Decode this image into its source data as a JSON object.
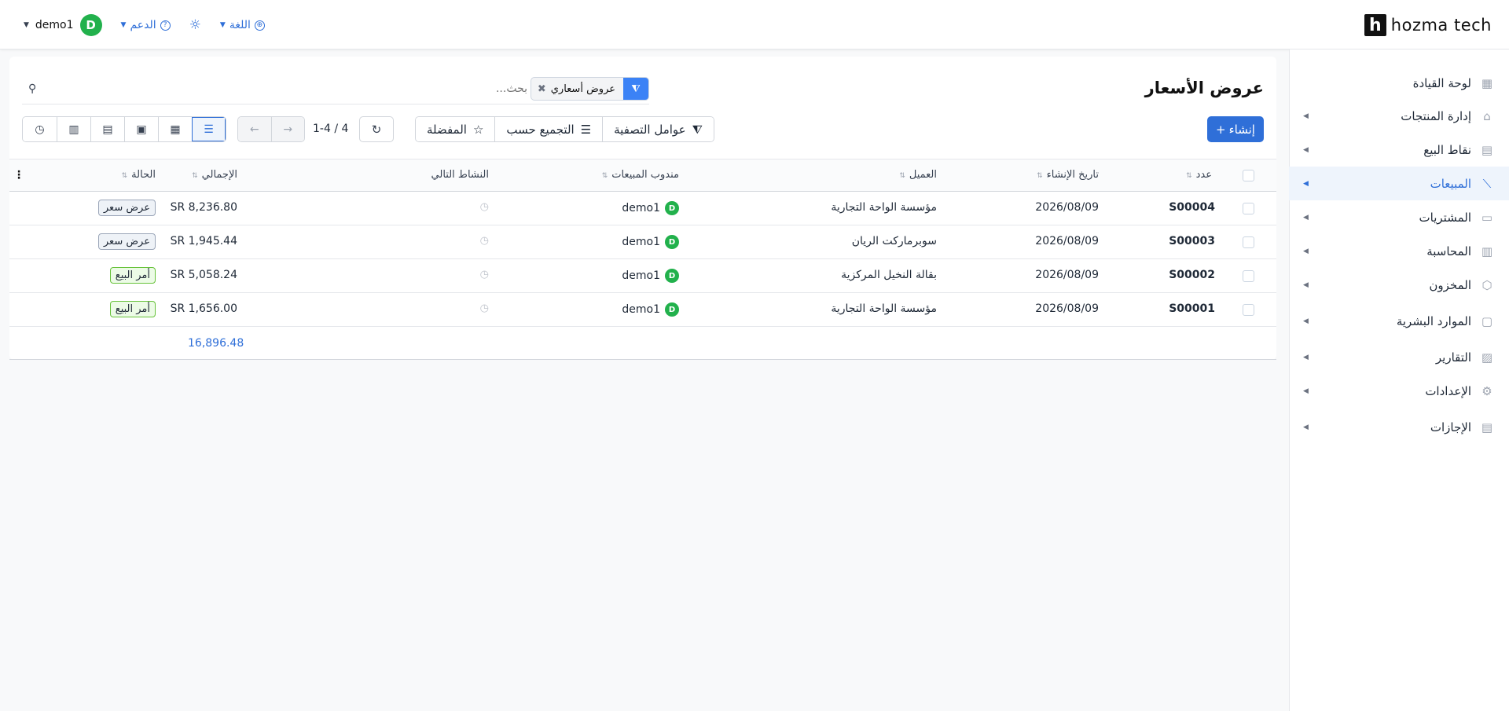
{
  "brand": {
    "mark": "h",
    "name": "hozma tech"
  },
  "topbar": {
    "user_name": "demo1",
    "user_initial": "D",
    "support_label": "الدعم",
    "language_label": "اللغة"
  },
  "sidebar": {
    "items": [
      {
        "label": "لوحة القيادة",
        "icon": "dashboard-icon",
        "glyph": "▦",
        "has_submenu": false
      },
      {
        "label": "إدارة المنتجات",
        "icon": "tag-icon",
        "glyph": "⌂",
        "has_submenu": true
      },
      {
        "label": "نقاط البيع",
        "icon": "store-icon",
        "glyph": "▤",
        "has_submenu": true
      },
      {
        "label": "المبيعات",
        "icon": "chart-line-icon",
        "glyph": "⟋",
        "has_submenu": true,
        "active": true
      },
      {
        "label": "المشتريات",
        "icon": "wallet-icon",
        "glyph": "▭",
        "has_submenu": true
      },
      {
        "label": "المحاسبة",
        "icon": "ledger-icon",
        "glyph": "▥",
        "has_submenu": true
      },
      {
        "label": "المخزون",
        "icon": "box-icon",
        "glyph": "⬡",
        "has_submenu": true
      },
      {
        "label": "الموارد البشرية",
        "icon": "document-icon",
        "glyph": "▢",
        "has_submenu": true
      },
      {
        "label": "التقارير",
        "icon": "report-icon",
        "glyph": "▨",
        "has_submenu": true
      },
      {
        "label": "الإعدادات",
        "icon": "gear-icon",
        "glyph": "⚙",
        "has_submenu": true
      },
      {
        "label": "الإجازات",
        "icon": "calendar-doc-icon",
        "glyph": "▤",
        "has_submenu": true
      }
    ]
  },
  "page": {
    "title": "عروض الأسعار",
    "create_label": "إنشاء",
    "search": {
      "facet_label": "عروض أسعاري",
      "placeholder": "بحث..."
    },
    "toolbar": {
      "filters_label": "عوامل التصفية",
      "group_by_label": "التجميع حسب",
      "favorites_label": "المفضلة"
    },
    "pager": "1-4 / 4"
  },
  "table": {
    "columns": {
      "number": "عدد",
      "created": "تاريخ الإنشاء",
      "customer": "العميل",
      "salesperson": "مندوب المبيعات",
      "next_activity": "النشاط التالي",
      "total": "الإجمالي",
      "status": "الحالة"
    },
    "rows": [
      {
        "number": "S00004",
        "created": "2026/08/09",
        "customer": "مؤسسة الواحة التجارية",
        "salesperson": "demo1",
        "initial": "D",
        "total": "SR 8,236.80",
        "status": "عرض سعر",
        "status_type": "quote"
      },
      {
        "number": "S00003",
        "created": "2026/08/09",
        "customer": "سوبرماركت الريان",
        "salesperson": "demo1",
        "initial": "D",
        "total": "SR 1,945.44",
        "status": "عرض سعر",
        "status_type": "quote"
      },
      {
        "number": "S00002",
        "created": "2026/08/09",
        "customer": "بقالة النخيل المركزية",
        "salesperson": "demo1",
        "initial": "D",
        "total": "SR 5,058.24",
        "status": "أمر البيع",
        "status_type": "order"
      },
      {
        "number": "S00001",
        "created": "2026/08/09",
        "customer": "مؤسسة الواحة التجارية",
        "salesperson": "demo1",
        "initial": "D",
        "total": "SR 1,656.00",
        "status": "أمر البيع",
        "status_type": "order"
      }
    ],
    "sum_total": "16,896.48"
  },
  "colors": {
    "accent": "#2f6fd8",
    "avatar": "#22b14c",
    "active_bg": "#eef4fc"
  }
}
